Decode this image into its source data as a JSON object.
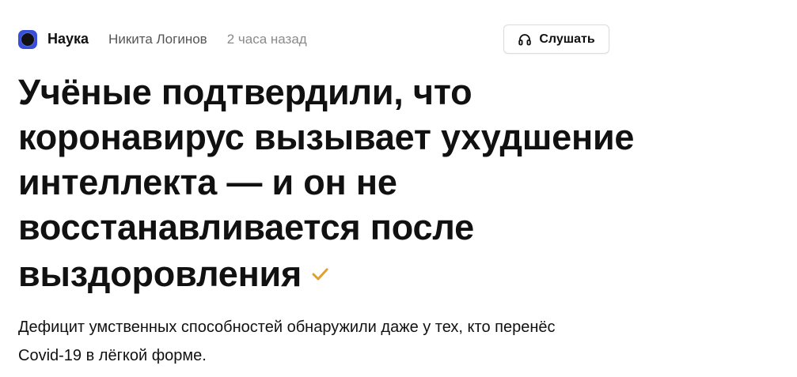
{
  "header": {
    "channel_name": "Наука",
    "channel_logo_icon": "channel-logo-icon",
    "author": "Никита Логинов",
    "published": "2 часа назад",
    "listen_button": {
      "label": "Слушать",
      "icon": "headphones-icon"
    }
  },
  "article": {
    "title": "Учёные подтвердили, что коронавирус вызывает ухудшение интеллекта — и он не восстанавливается после выздоровления",
    "verified_icon": "checkmark-icon",
    "lead": "Дефицит умственных способностей обнаружили даже у тех, кто перенёс Covid-19 в лёгкой форме."
  },
  "colors": {
    "accent_check": "#e0a030",
    "logo_background": "#3a4fd8",
    "text": "#111111",
    "muted_text": "#8a8a8a"
  }
}
